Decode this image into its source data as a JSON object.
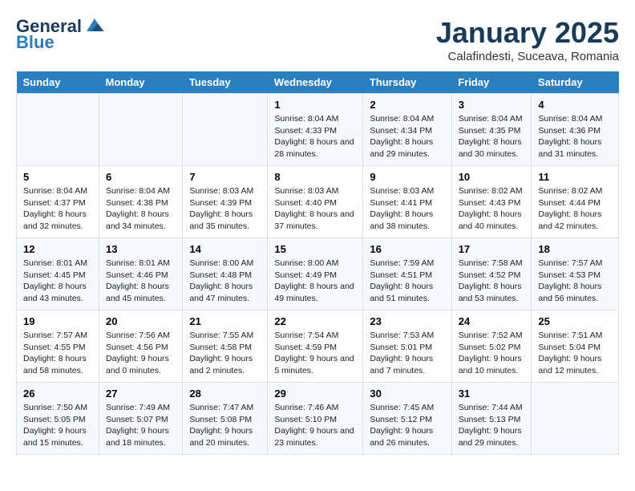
{
  "logo": {
    "line1": "General",
    "line2": "Blue"
  },
  "title": "January 2025",
  "subtitle": "Calafindesti, Suceava, Romania",
  "weekdays": [
    "Sunday",
    "Monday",
    "Tuesday",
    "Wednesday",
    "Thursday",
    "Friday",
    "Saturday"
  ],
  "weeks": [
    [
      {
        "day": "",
        "sunrise": "",
        "sunset": "",
        "daylight": ""
      },
      {
        "day": "",
        "sunrise": "",
        "sunset": "",
        "daylight": ""
      },
      {
        "day": "",
        "sunrise": "",
        "sunset": "",
        "daylight": ""
      },
      {
        "day": "1",
        "sunrise": "Sunrise: 8:04 AM",
        "sunset": "Sunset: 4:33 PM",
        "daylight": "Daylight: 8 hours and 28 minutes."
      },
      {
        "day": "2",
        "sunrise": "Sunrise: 8:04 AM",
        "sunset": "Sunset: 4:34 PM",
        "daylight": "Daylight: 8 hours and 29 minutes."
      },
      {
        "day": "3",
        "sunrise": "Sunrise: 8:04 AM",
        "sunset": "Sunset: 4:35 PM",
        "daylight": "Daylight: 8 hours and 30 minutes."
      },
      {
        "day": "4",
        "sunrise": "Sunrise: 8:04 AM",
        "sunset": "Sunset: 4:36 PM",
        "daylight": "Daylight: 8 hours and 31 minutes."
      }
    ],
    [
      {
        "day": "5",
        "sunrise": "Sunrise: 8:04 AM",
        "sunset": "Sunset: 4:37 PM",
        "daylight": "Daylight: 8 hours and 32 minutes."
      },
      {
        "day": "6",
        "sunrise": "Sunrise: 8:04 AM",
        "sunset": "Sunset: 4:38 PM",
        "daylight": "Daylight: 8 hours and 34 minutes."
      },
      {
        "day": "7",
        "sunrise": "Sunrise: 8:03 AM",
        "sunset": "Sunset: 4:39 PM",
        "daylight": "Daylight: 8 hours and 35 minutes."
      },
      {
        "day": "8",
        "sunrise": "Sunrise: 8:03 AM",
        "sunset": "Sunset: 4:40 PM",
        "daylight": "Daylight: 8 hours and 37 minutes."
      },
      {
        "day": "9",
        "sunrise": "Sunrise: 8:03 AM",
        "sunset": "Sunset: 4:41 PM",
        "daylight": "Daylight: 8 hours and 38 minutes."
      },
      {
        "day": "10",
        "sunrise": "Sunrise: 8:02 AM",
        "sunset": "Sunset: 4:43 PM",
        "daylight": "Daylight: 8 hours and 40 minutes."
      },
      {
        "day": "11",
        "sunrise": "Sunrise: 8:02 AM",
        "sunset": "Sunset: 4:44 PM",
        "daylight": "Daylight: 8 hours and 42 minutes."
      }
    ],
    [
      {
        "day": "12",
        "sunrise": "Sunrise: 8:01 AM",
        "sunset": "Sunset: 4:45 PM",
        "daylight": "Daylight: 8 hours and 43 minutes."
      },
      {
        "day": "13",
        "sunrise": "Sunrise: 8:01 AM",
        "sunset": "Sunset: 4:46 PM",
        "daylight": "Daylight: 8 hours and 45 minutes."
      },
      {
        "day": "14",
        "sunrise": "Sunrise: 8:00 AM",
        "sunset": "Sunset: 4:48 PM",
        "daylight": "Daylight: 8 hours and 47 minutes."
      },
      {
        "day": "15",
        "sunrise": "Sunrise: 8:00 AM",
        "sunset": "Sunset: 4:49 PM",
        "daylight": "Daylight: 8 hours and 49 minutes."
      },
      {
        "day": "16",
        "sunrise": "Sunrise: 7:59 AM",
        "sunset": "Sunset: 4:51 PM",
        "daylight": "Daylight: 8 hours and 51 minutes."
      },
      {
        "day": "17",
        "sunrise": "Sunrise: 7:58 AM",
        "sunset": "Sunset: 4:52 PM",
        "daylight": "Daylight: 8 hours and 53 minutes."
      },
      {
        "day": "18",
        "sunrise": "Sunrise: 7:57 AM",
        "sunset": "Sunset: 4:53 PM",
        "daylight": "Daylight: 8 hours and 56 minutes."
      }
    ],
    [
      {
        "day": "19",
        "sunrise": "Sunrise: 7:57 AM",
        "sunset": "Sunset: 4:55 PM",
        "daylight": "Daylight: 8 hours and 58 minutes."
      },
      {
        "day": "20",
        "sunrise": "Sunrise: 7:56 AM",
        "sunset": "Sunset: 4:56 PM",
        "daylight": "Daylight: 9 hours and 0 minutes."
      },
      {
        "day": "21",
        "sunrise": "Sunrise: 7:55 AM",
        "sunset": "Sunset: 4:58 PM",
        "daylight": "Daylight: 9 hours and 2 minutes."
      },
      {
        "day": "22",
        "sunrise": "Sunrise: 7:54 AM",
        "sunset": "Sunset: 4:59 PM",
        "daylight": "Daylight: 9 hours and 5 minutes."
      },
      {
        "day": "23",
        "sunrise": "Sunrise: 7:53 AM",
        "sunset": "Sunset: 5:01 PM",
        "daylight": "Daylight: 9 hours and 7 minutes."
      },
      {
        "day": "24",
        "sunrise": "Sunrise: 7:52 AM",
        "sunset": "Sunset: 5:02 PM",
        "daylight": "Daylight: 9 hours and 10 minutes."
      },
      {
        "day": "25",
        "sunrise": "Sunrise: 7:51 AM",
        "sunset": "Sunset: 5:04 PM",
        "daylight": "Daylight: 9 hours and 12 minutes."
      }
    ],
    [
      {
        "day": "26",
        "sunrise": "Sunrise: 7:50 AM",
        "sunset": "Sunset: 5:05 PM",
        "daylight": "Daylight: 9 hours and 15 minutes."
      },
      {
        "day": "27",
        "sunrise": "Sunrise: 7:49 AM",
        "sunset": "Sunset: 5:07 PM",
        "daylight": "Daylight: 9 hours and 18 minutes."
      },
      {
        "day": "28",
        "sunrise": "Sunrise: 7:47 AM",
        "sunset": "Sunset: 5:08 PM",
        "daylight": "Daylight: 9 hours and 20 minutes."
      },
      {
        "day": "29",
        "sunrise": "Sunrise: 7:46 AM",
        "sunset": "Sunset: 5:10 PM",
        "daylight": "Daylight: 9 hours and 23 minutes."
      },
      {
        "day": "30",
        "sunrise": "Sunrise: 7:45 AM",
        "sunset": "Sunset: 5:12 PM",
        "daylight": "Daylight: 9 hours and 26 minutes."
      },
      {
        "day": "31",
        "sunrise": "Sunrise: 7:44 AM",
        "sunset": "Sunset: 5:13 PM",
        "daylight": "Daylight: 9 hours and 29 minutes."
      },
      {
        "day": "",
        "sunrise": "",
        "sunset": "",
        "daylight": ""
      }
    ]
  ]
}
